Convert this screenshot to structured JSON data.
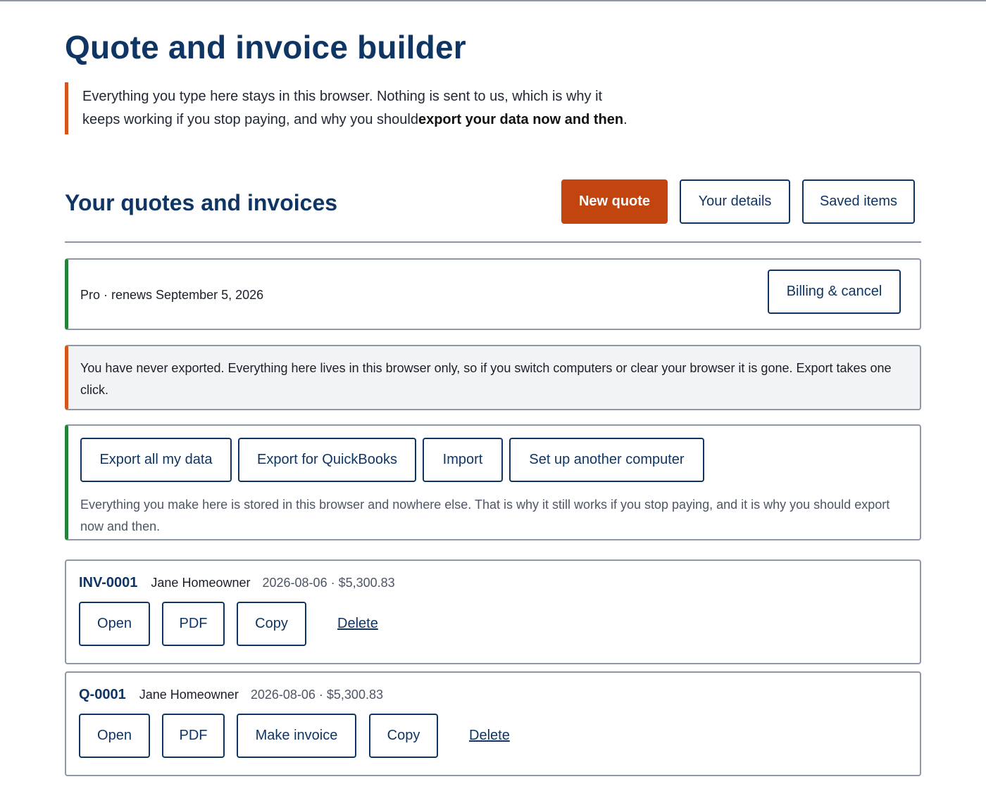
{
  "page": {
    "title": "Quote and invoice builder",
    "intro": {
      "text": "Everything you type here stays in this browser. Nothing is sent to us, which is why it keeps working if you stop paying, and why you should",
      "bold": "export your data now and then",
      "end": "."
    }
  },
  "section": {
    "title": "Your quotes and invoices",
    "actions": {
      "new_quote": "New quote",
      "your_details": "Your details",
      "saved_items": "Saved items"
    }
  },
  "plan": {
    "status": "Pro · renews September 5, 2026",
    "billing_label": "Billing & cancel"
  },
  "warning": {
    "text": "You have never exported. Everything here lives in this browser only, so if you switch computers or clear your browser it is gone. Export takes one click."
  },
  "export": {
    "export_all": "Export all my data",
    "export_quickbooks": "Export for QuickBooks",
    "import": "Import",
    "setup_computer": "Set up another computer",
    "note": "Everything you make here is stored in this browser and nowhere else. That is why it still works if you stop paying, and it is why you should export now and then."
  },
  "documents": [
    {
      "id": "INV-0001",
      "client": "Jane Homeowner",
      "meta": "2026-08-06 · $5,300.83",
      "open": "Open",
      "pdf": "PDF",
      "copy": "Copy",
      "delete": "Delete"
    },
    {
      "id": "Q-0001",
      "client": "Jane Homeowner",
      "meta": "2026-08-06 · $5,300.83",
      "open": "Open",
      "pdf": "PDF",
      "make_invoice": "Make invoice",
      "copy": "Copy",
      "delete": "Delete"
    }
  ],
  "colors": {
    "heading": "#0f3564",
    "primary": "#c2440f",
    "accent_orange": "#d4561c",
    "accent_green": "#23833a",
    "border": "#8e96a8"
  }
}
